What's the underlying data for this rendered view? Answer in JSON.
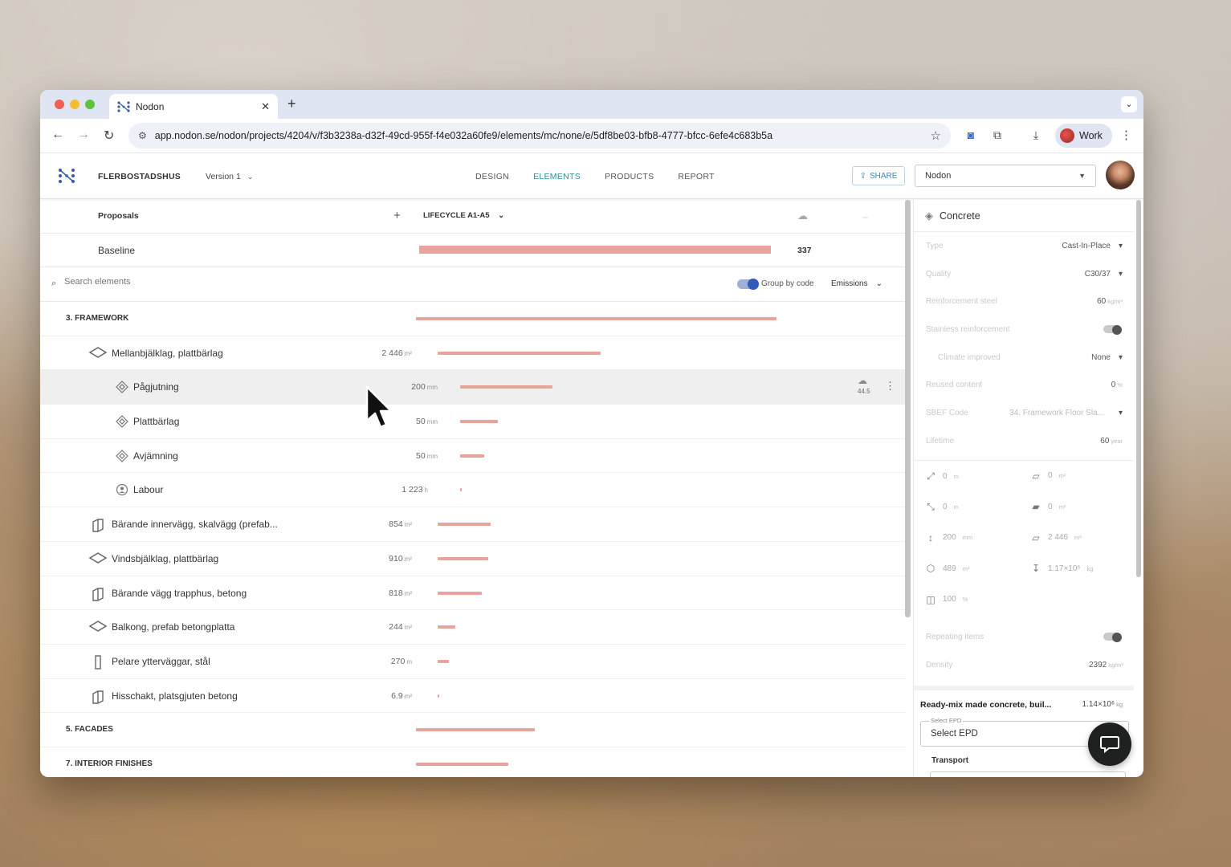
{
  "browser": {
    "tab_title": "Nodon",
    "tab_close": "✕",
    "new_tab": "+",
    "url": "app.nodon.se/nodon/projects/4204/v/f3b3238a-d32f-49cd-955f-f4e032a60fe9/elements/mc/none/e/5df8be03-bfb8-4777-bfcc-6efe4c683b5a",
    "profile_label": "Work",
    "traffic_colors": [
      "#ee5f57",
      "#f5bd31",
      "#5fc33f"
    ]
  },
  "header": {
    "project_name": "FLERBOSTADSHUS",
    "version_label": "Version 1",
    "nav": [
      "DESIGN",
      "ELEMENTS",
      "PRODUCTS",
      "REPORT"
    ],
    "active_nav": "ELEMENTS",
    "share_label": "SHARE",
    "org_select": "Nodon",
    "accent_color": "#2d8f9a"
  },
  "proposals": {
    "label": "Proposals",
    "add": "+",
    "lifecycle": "LIFECYCLE A1-A5",
    "baseline_label": "Baseline",
    "baseline_value": "337",
    "baseline_dash": "–"
  },
  "search": {
    "placeholder": "Search elements",
    "group_by_label": "Group by code",
    "group_by_on": true,
    "emissions_label": "Emissions"
  },
  "elements": [
    {
      "kind": "group",
      "label": "3. FRAMEWORK",
      "bar": 0.82
    },
    {
      "kind": "element",
      "icon": "slab-icon",
      "label": "Mellanbjälklag, plattbärlag",
      "qty": "2 446",
      "unit": "m²",
      "bar": 0.37
    },
    {
      "kind": "product",
      "icon": "product-icon",
      "label": "Pågjutning",
      "qty": "200",
      "unit": "mm",
      "bar": 0.21,
      "hover": true,
      "co2": "44.5"
    },
    {
      "kind": "product",
      "icon": "product-icon",
      "label": "Plattbärlag",
      "qty": "50",
      "unit": "mm",
      "bar": 0.085
    },
    {
      "kind": "product",
      "icon": "product-icon",
      "label": "Avjämning",
      "qty": "50",
      "unit": "mm",
      "bar": 0.055
    },
    {
      "kind": "product",
      "icon": "labour-icon",
      "label": "Labour",
      "qty": "1 223",
      "unit": "h",
      "bar": 0.003
    },
    {
      "kind": "element",
      "icon": "wall-icon",
      "label": "Bärande innervägg, skalvägg (prefab...",
      "qty": "854",
      "unit": "m²",
      "bar": 0.12
    },
    {
      "kind": "element",
      "icon": "slab-icon",
      "label": "Vindsbjälklag, plattbärlag",
      "qty": "910",
      "unit": "m²",
      "bar": 0.115
    },
    {
      "kind": "element",
      "icon": "wall-icon",
      "label": "Bärande vägg trapphus, betong",
      "qty": "818",
      "unit": "m²",
      "bar": 0.1
    },
    {
      "kind": "element",
      "icon": "slab-icon",
      "label": "Balkong, prefab betongplatta",
      "qty": "244",
      "unit": "m²",
      "bar": 0.04
    },
    {
      "kind": "element",
      "icon": "column-icon",
      "label": "Pelare ytterväggar, stål",
      "qty": "270",
      "unit": "m",
      "bar": 0.025
    },
    {
      "kind": "element",
      "icon": "wall-icon",
      "label": "Hisschakt, platsgjuten betong",
      "qty": "6.9",
      "unit": "m²",
      "bar": 0.004
    },
    {
      "kind": "group",
      "label": "5. FACADES",
      "bar": 0.27
    },
    {
      "kind": "group",
      "label": "7. INTERIOR FINISHES",
      "bar": 0.21
    }
  ],
  "panel": {
    "title": "Concrete",
    "props": [
      {
        "k": "Type",
        "v": "Cast-In-Place",
        "dropdown": true
      },
      {
        "k": "Quality",
        "v": "C30/37",
        "dropdown": true
      },
      {
        "k": "Reinforcement steel",
        "v": "60",
        "unit": "kg/m³"
      },
      {
        "k": "Stainless reinforcement",
        "toggle": true
      },
      {
        "k": "Climate improved",
        "v": "None",
        "dropdown": true,
        "indent": true
      },
      {
        "k": "Reused content",
        "v": "0",
        "unit": "%"
      },
      {
        "k": "SBEF Code",
        "v": "34. Framework Floor Sla...",
        "dropdown": true,
        "dim": true
      },
      {
        "k": "Lifetime",
        "v": "60",
        "unit": "year"
      }
    ],
    "dims": [
      {
        "icon": "length-icon",
        "v": "0",
        "unit": "m",
        "glyph": "⤢"
      },
      {
        "icon": "area-icon",
        "v": "0",
        "unit": "m²",
        "glyph": "▱"
      },
      {
        "icon": "width-icon",
        "v": "0",
        "unit": "m",
        "glyph": "⤡"
      },
      {
        "icon": "side-area-icon",
        "v": "0",
        "unit": "m²",
        "glyph": "▰"
      },
      {
        "icon": "height-icon",
        "v": "200",
        "unit": "mm",
        "glyph": "↕"
      },
      {
        "icon": "surface-area-icon",
        "v": "2 446",
        "unit": "m²",
        "glyph": "▱"
      },
      {
        "icon": "volume-icon",
        "v": "489",
        "unit": "m³",
        "glyph": "⬡"
      },
      {
        "icon": "weight-icon",
        "v": "1.17×10⁶",
        "unit": "kg",
        "glyph": "↧"
      },
      {
        "icon": "percent-icon",
        "v": "100",
        "unit": "%",
        "glyph": "◫"
      }
    ],
    "repeating_label": "Repeating items",
    "density_label": "Density",
    "density_value": "2392",
    "density_unit": "kg/m³",
    "epd_name": "Ready-mix made concrete, buil...",
    "epd_value": "1.14×10⁶",
    "epd_unit": "kg",
    "select_epd_legend": "Select EPD",
    "select_epd_value": "Select EPD",
    "transport_label": "Transport"
  }
}
